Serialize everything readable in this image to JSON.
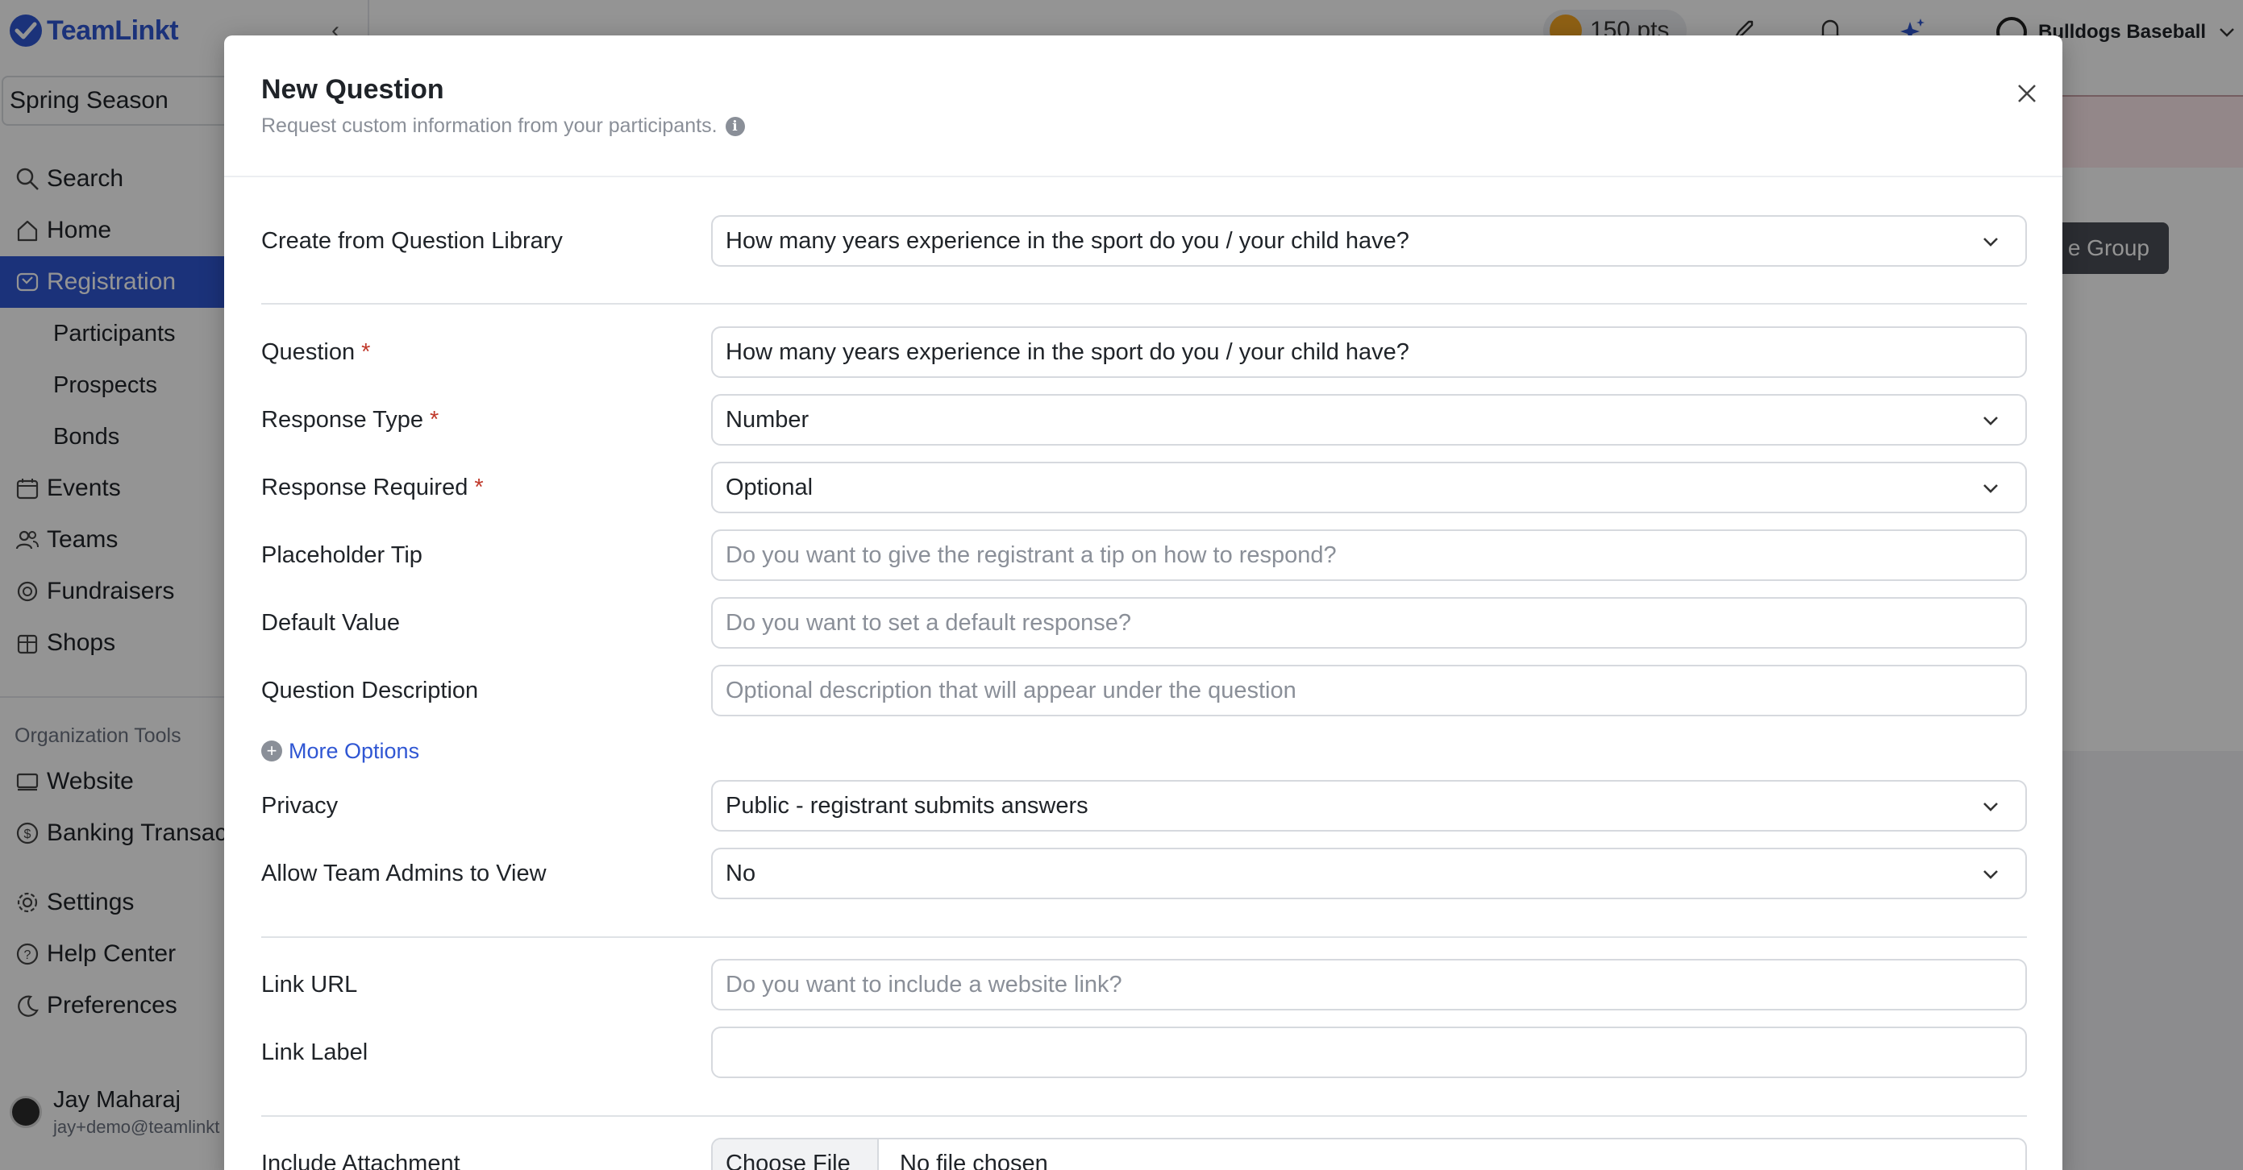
{
  "app": {
    "brand": "TeamLinkt",
    "season": "Spring Season",
    "nav": [
      {
        "label": "Search",
        "icon": "search-icon"
      },
      {
        "label": "Home",
        "icon": "home-icon"
      },
      {
        "label": "Registration",
        "icon": "registration-icon",
        "active": true
      },
      {
        "label": "Participants",
        "sub": true
      },
      {
        "label": "Prospects",
        "sub": true
      },
      {
        "label": "Bonds",
        "sub": true
      },
      {
        "label": "Events",
        "icon": "calendar-icon"
      },
      {
        "label": "Teams",
        "icon": "users-icon"
      },
      {
        "label": "Fundraisers",
        "icon": "fundraiser-icon"
      },
      {
        "label": "Shops",
        "icon": "shop-icon"
      }
    ],
    "org_tools_heading": "Organization Tools",
    "org_tools": [
      {
        "label": "Website",
        "icon": "monitor-icon"
      },
      {
        "label": "Banking Transac",
        "icon": "dollar-icon"
      }
    ],
    "bottom_nav": [
      {
        "label": "Settings",
        "icon": "gear-icon"
      },
      {
        "label": "Help Center",
        "icon": "help-icon"
      },
      {
        "label": "Preferences",
        "icon": "moon-icon"
      }
    ],
    "user": {
      "name": "Jay Maharaj",
      "email": "jay+demo@teamlinkt"
    },
    "points": "150 pts",
    "team": "Bulldogs Baseball",
    "group_button": "e Group",
    "accent": "#2f56d3"
  },
  "modal": {
    "title": "New Question",
    "subtitle": "Request custom information from your participants.",
    "library": {
      "label": "Create from Question Library",
      "value": "How many years experience in the sport do you / your child have?"
    },
    "question": {
      "label": "Question",
      "value": "How many years experience in the sport do you / your child have?"
    },
    "response_type": {
      "label": "Response Type",
      "value": "Number"
    },
    "response_required": {
      "label": "Response Required",
      "value": "Optional"
    },
    "placeholder_tip": {
      "label": "Placeholder Tip",
      "placeholder": "Do you want to give the registrant a tip on how to respond?"
    },
    "default_value": {
      "label": "Default Value",
      "placeholder": "Do you want to set a default response?"
    },
    "description": {
      "label": "Question Description",
      "placeholder": "Optional description that will appear under the question"
    },
    "more_options": "More Options",
    "privacy": {
      "label": "Privacy",
      "value": "Public - registrant submits answers"
    },
    "team_admins": {
      "label": "Allow Team Admins to View",
      "value": "No"
    },
    "link_url": {
      "label": "Link URL",
      "placeholder": "Do you want to include a website link?"
    },
    "link_label": {
      "label": "Link Label",
      "placeholder": ""
    },
    "attachment": {
      "label": "Include Attachment",
      "button": "Choose File",
      "status": "No file chosen"
    },
    "required_mark": "*"
  }
}
